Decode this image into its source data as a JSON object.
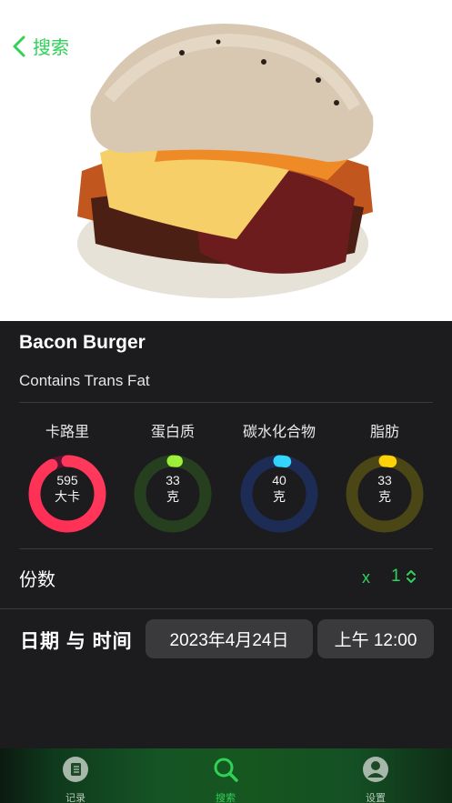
{
  "nav": {
    "back_label": "搜索"
  },
  "food": {
    "name": "Bacon Burger",
    "note": "Contains Trans Fat"
  },
  "nutrients": [
    {
      "label": "卡路里",
      "value": "595",
      "unit": "大卡",
      "progress": 0.92,
      "track": "#5a1233",
      "color_start": "#ff2d55",
      "color_end": "#ff3b5c"
    },
    {
      "label": "蛋白质",
      "value": "33",
      "unit": "克",
      "progress": 0.02,
      "track": "#26401f",
      "color_start": "#7ddc1f",
      "color_end": "#a6f542"
    },
    {
      "label": "碳水化合物",
      "value": "40",
      "unit": "克",
      "progress": 0.03,
      "track": "#1c2c55",
      "color_start": "#22c4f0",
      "color_end": "#3ad8ff"
    },
    {
      "label": "脂肪",
      "value": "33",
      "unit": "克",
      "progress": 0.03,
      "track": "#4a4615",
      "color_start": "#f5c400",
      "color_end": "#ffd60a"
    }
  ],
  "servings": {
    "label": "份数",
    "x": "x",
    "count": "1"
  },
  "datetime": {
    "label": "日期 与 时间",
    "date": "2023年4月24日",
    "time": "上午 12:00"
  },
  "tabs": [
    {
      "label": "记录",
      "icon": "journal-icon"
    },
    {
      "label": "搜索",
      "icon": "search-icon"
    },
    {
      "label": "设置",
      "icon": "person-icon"
    }
  ],
  "colors": {
    "accent": "#30d158",
    "background": "#1c1c1e"
  }
}
